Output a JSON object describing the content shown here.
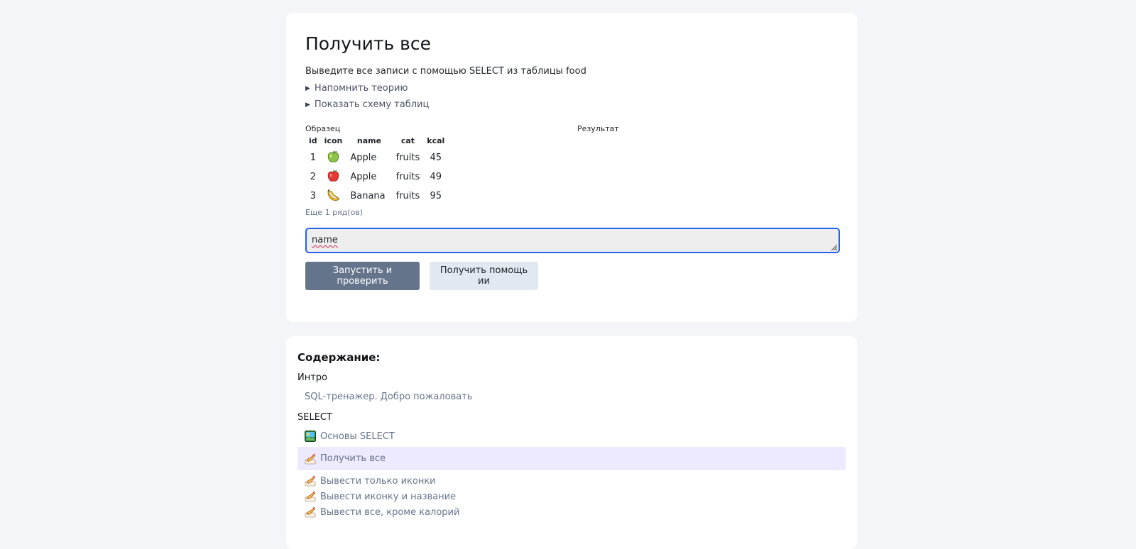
{
  "task": {
    "title": "Получить все",
    "description": "Выведите все записи с помощью SELECT из таблицы food",
    "details": [
      {
        "label": "Напомнить теорию"
      },
      {
        "label": "Показать схему таблиц"
      }
    ],
    "sample_label": "Образец",
    "result_label": "Результат",
    "sample_table": {
      "columns": [
        "id",
        "icon",
        "name",
        "cat",
        "kcal"
      ],
      "rows": [
        {
          "id": "1",
          "icon": "green-apple-icon",
          "name": "Apple",
          "cat": "fruits",
          "kcal": "45"
        },
        {
          "id": "2",
          "icon": "red-apple-icon",
          "name": "Apple",
          "cat": "fruits",
          "kcal": "49"
        },
        {
          "id": "3",
          "icon": "banana-icon",
          "name": "Banana",
          "cat": "fruits",
          "kcal": "95"
        }
      ]
    },
    "more_rows": "Еще 1 ряд(ов)",
    "editor_value": "name",
    "run_button": "Запустить и проверить",
    "help_button": "Получить помощь ии"
  },
  "toc": {
    "title": "Содержание:",
    "sections": [
      {
        "name": "Интро",
        "items": [
          {
            "label": "SQL-тренажер. Добро пожаловать",
            "icon": "",
            "active": false
          }
        ]
      },
      {
        "name": "SELECT",
        "items": [
          {
            "label": "Основы SELECT",
            "icon": "picture-icon",
            "active": false
          },
          {
            "label": "Получить все",
            "icon": "writing-hand-icon",
            "active": true
          },
          {
            "label": "Вывести только иконки",
            "icon": "writing-hand-icon",
            "active": false
          },
          {
            "label": "Вывести иконку и название",
            "icon": "writing-hand-icon",
            "active": false
          },
          {
            "label": "Вывести все, кроме калорий",
            "icon": "writing-hand-icon",
            "active": false
          }
        ]
      }
    ]
  },
  "colors": {
    "accent_blue": "#2563eb",
    "button_primary": "#64748b",
    "active_item_bg": "#ede9fe"
  }
}
